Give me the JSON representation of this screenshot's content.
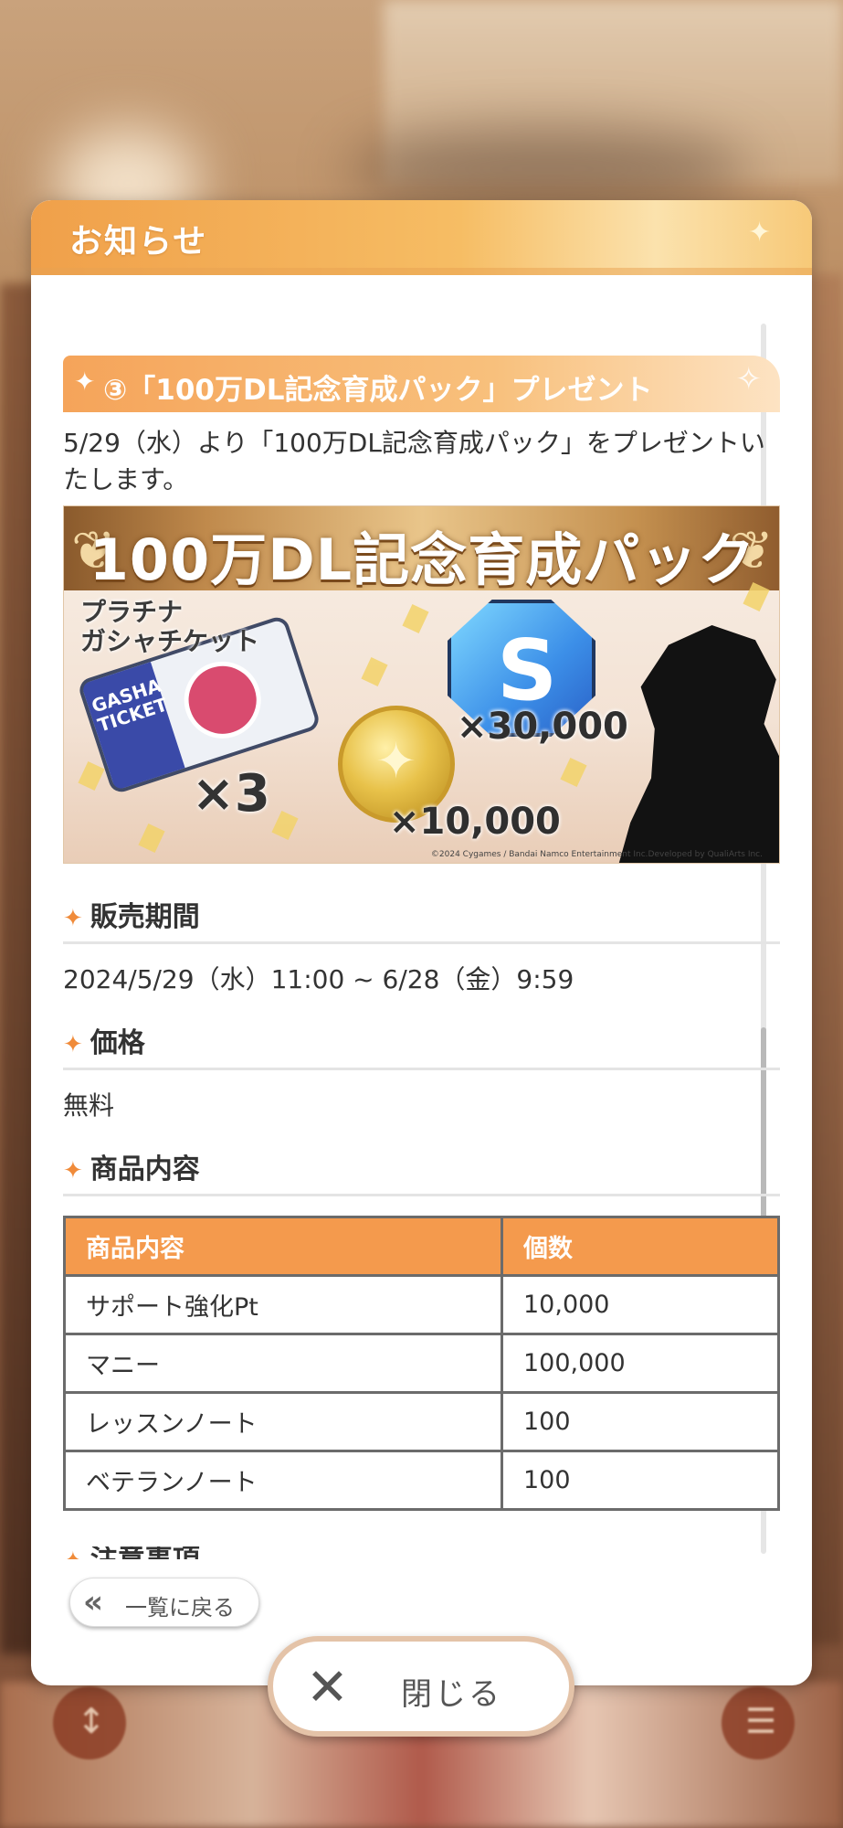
{
  "dialog": {
    "title": "お知らせ",
    "section_title": "③「100万DL記念育成パック」プレゼント",
    "intro": "5/29（水）より「100万DL記念育成パック」をプレゼントいたします。"
  },
  "promo": {
    "title": "100万DL記念育成パック",
    "ticket_label": "プラチナ\nガシャチケット",
    "ticket_text": "GASHA TICKET",
    "ticket_qty": "×3",
    "coin_qty": "×10,000",
    "s_letter": "S",
    "s_qty": "×30,000",
    "copyright": "©2024 Cygames / Bandai Namco Entertainment Inc.Developed by QualiArts Inc."
  },
  "sale_period": {
    "heading": "販売期間",
    "value": "2024/5/29（水）11:00 ~ 6/28（金）9:59"
  },
  "price": {
    "heading": "価格",
    "value": "無料"
  },
  "contents": {
    "heading": "商品内容",
    "columns": [
      "商品内容",
      "個数"
    ],
    "rows": [
      [
        "サポート強化Pt",
        "10,000"
      ],
      [
        "マニー",
        "100,000"
      ],
      [
        "レッスンノート",
        "100"
      ],
      [
        "ベテランノート",
        "100"
      ]
    ]
  },
  "notes_heading": "注意事項",
  "back_label": "一覧に戻る",
  "close_label": "閉じる",
  "colors": {
    "accent": "#f49a4d",
    "header": "#f6bd64"
  }
}
